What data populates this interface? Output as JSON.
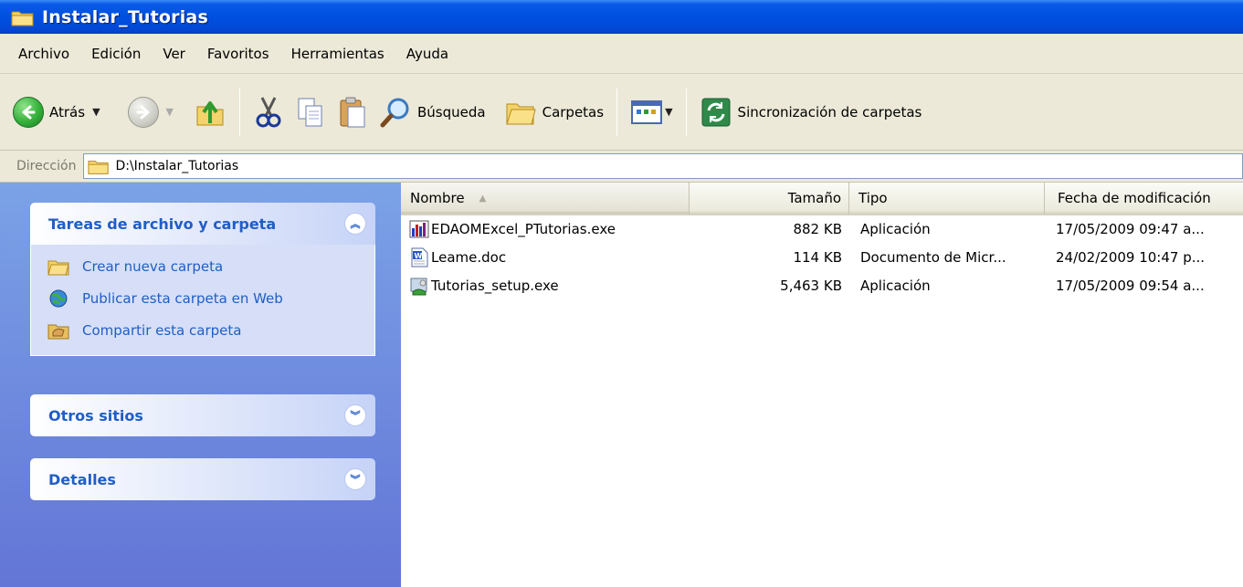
{
  "window": {
    "title": "Instalar_Tutorias"
  },
  "menu": [
    "Archivo",
    "Edición",
    "Ver",
    "Favoritos",
    "Herramientas",
    "Ayuda"
  ],
  "toolbar": {
    "back_label": "Atrás",
    "search_label": "Búsqueda",
    "folders_label": "Carpetas",
    "sync_label": "Sincronización de carpetas"
  },
  "address": {
    "label": "Dirección",
    "value": "D:\\Instalar_Tutorias"
  },
  "left_panel": {
    "tasks_title": "Tareas de archivo y carpeta",
    "tasks": [
      "Crear nueva carpeta",
      "Publicar esta carpeta en Web",
      "Compartir esta carpeta"
    ],
    "other_title": "Otros sitios",
    "details_title": "Detalles"
  },
  "columns": {
    "name": "Nombre",
    "size": "Tamaño",
    "type": "Tipo",
    "modified": "Fecha de modificación"
  },
  "files": [
    {
      "name": "EDAOMExcel_PTutorias.exe",
      "size": "882 KB",
      "type": "Aplicación",
      "modified": "17/05/2009 09:47 a...",
      "icon": "exe-app-icon"
    },
    {
      "name": "Leame.doc",
      "size": "114 KB",
      "type": "Documento de Micr...",
      "modified": "24/02/2009 10:47 p...",
      "icon": "word-doc-icon"
    },
    {
      "name": "Tutorias_setup.exe",
      "size": "5,463 KB",
      "type": "Aplicación",
      "modified": "17/05/2009 09:54 a...",
      "icon": "setup-icon"
    }
  ]
}
